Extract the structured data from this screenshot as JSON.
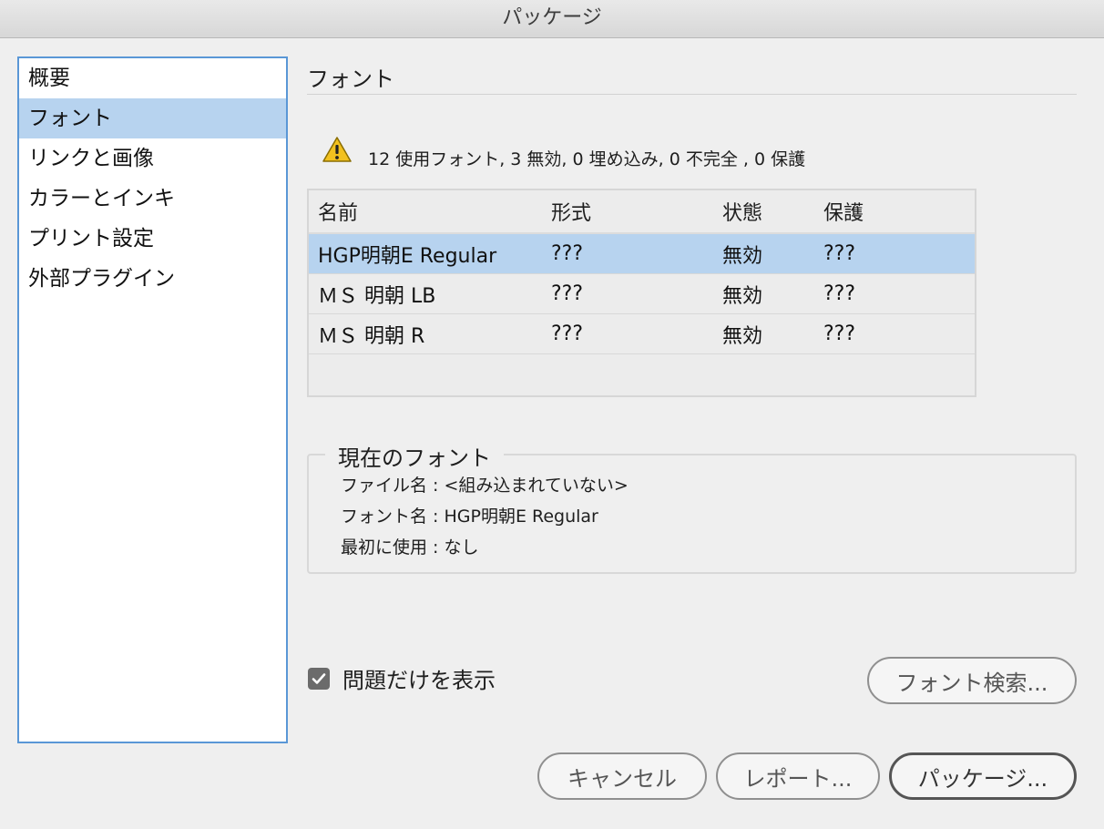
{
  "window": {
    "title": "パッケージ"
  },
  "sidebar": {
    "items": [
      {
        "label": "概要"
      },
      {
        "label": "フォント"
      },
      {
        "label": "リンクと画像"
      },
      {
        "label": "カラーとインキ"
      },
      {
        "label": "プリント設定"
      },
      {
        "label": "外部プラグイン"
      }
    ],
    "selected_index": 1
  },
  "main": {
    "section_title": "フォント",
    "summary_text": "12 使用フォント, 3 無効, 0 埋め込み, 0 不完全 , 0 保護",
    "table": {
      "columns": [
        "名前",
        "形式",
        "状態",
        "保護"
      ],
      "rows": [
        {
          "name": "HGP明朝E Regular",
          "format": "???",
          "status": "無効",
          "protect": "???"
        },
        {
          "name": "ＭＳ 明朝 LB",
          "format": "???",
          "status": "無効",
          "protect": "???"
        },
        {
          "name": "ＭＳ 明朝 R",
          "format": "???",
          "status": "無効",
          "protect": "???"
        }
      ],
      "selected_index": 0
    },
    "current_font": {
      "legend": "現在のフォント",
      "file_name_line": "ファイル名 : <組み込まれていない>",
      "font_name_line": "フォント名 : HGP明朝E Regular",
      "first_used_line": "最初に使用 : なし"
    },
    "show_problems_only": {
      "label": "問題だけを表示",
      "checked": true
    },
    "find_font_button": "フォント検索..."
  },
  "footer": {
    "cancel": "キャンセル",
    "report": "レポート...",
    "package": "パッケージ..."
  },
  "colors": {
    "selection": "#b7d3ef",
    "sidebar_border": "#5a97d6",
    "warning": "#f2c11f"
  }
}
